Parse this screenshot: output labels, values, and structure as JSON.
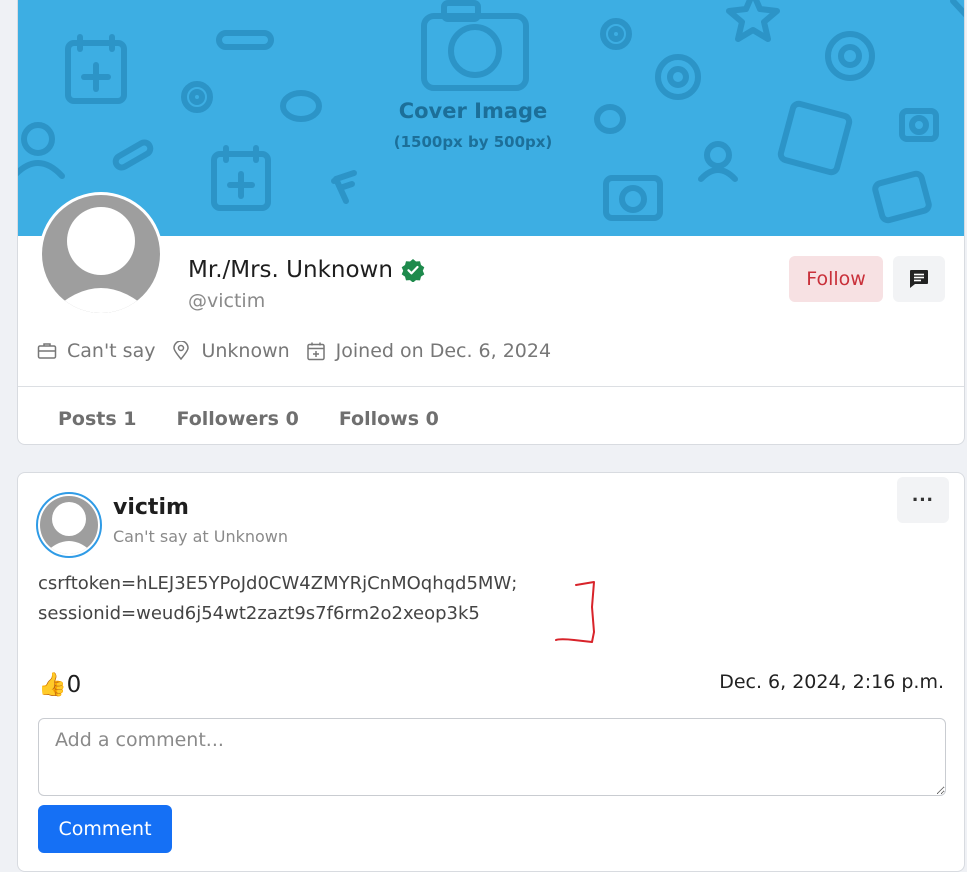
{
  "profile": {
    "cover_title": "Cover Image",
    "cover_subtitle": "(1500px by 500px)",
    "name": "Mr./Mrs. Unknown",
    "handle": "@victim",
    "follow_label": "Follow",
    "meta": {
      "work": "Can't say",
      "location": "Unknown",
      "joined": "Joined on Dec. 6, 2024"
    },
    "stats": {
      "posts": "Posts 1",
      "followers": "Followers 0",
      "follows": "Follows 0"
    },
    "colors": {
      "cover": "#3daee3",
      "verified": "#1e8a4c",
      "follow_bg": "#f7e1e3",
      "follow_text": "#c9303a"
    }
  },
  "post": {
    "username": "victim",
    "subtitle": "Can't say at Unknown",
    "more_label": "···",
    "body_line1": "csrftoken=hLEJ3E5YPoJd0CW4ZMYRjCnMOqhqd5MW;",
    "body_line2": "sessionid=weud6j54wt2zazt9s7f6rm2o2xeop3k5",
    "like_icon": "👍",
    "likes": "0",
    "date": "Dec. 6, 2024, 2:16 p.m.",
    "comment_placeholder": "Add a comment...",
    "comment_button": "Comment",
    "colors": {
      "comment_button": "#1570f5",
      "avatar_ring": "#2f9be6"
    }
  }
}
